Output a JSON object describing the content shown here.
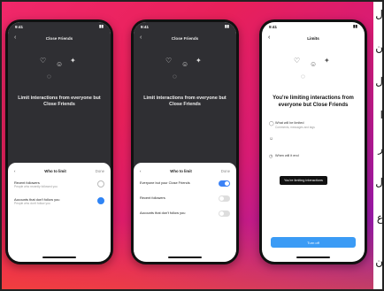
{
  "phone1": {
    "time": "9:41",
    "nav_title": "Close Friends",
    "headline": "Limit interactions from everyone but Close Friends",
    "sub": "",
    "sheet_title": "Who to limit",
    "sheet_action": "Done",
    "options": [
      {
        "label": "Recent followers",
        "detail": "People who recently followed you",
        "selected": false
      },
      {
        "label": "Accounts that don't follow you",
        "detail": "People who don't follow you",
        "selected": true
      }
    ]
  },
  "phone2": {
    "time": "9:41",
    "nav_title": "Close Friends",
    "headline": "Limit interactions from everyone but Close Friends",
    "sheet_title": "Who to limit",
    "sheet_action": "Done",
    "toggles": [
      {
        "label": "Everyone but your Close Friends",
        "detail": "",
        "on": true
      },
      {
        "label": "Recent followers",
        "detail": "",
        "on": false
      },
      {
        "label": "Accounts that don't follow you",
        "detail": "",
        "on": false
      }
    ]
  },
  "phone3": {
    "time": "9:41",
    "nav_title": "Limits",
    "headline": "You're limiting interactions from everyone but Close Friends",
    "items": [
      {
        "icon": "comment-icon",
        "label": "What will be limited",
        "detail": "Comments, messages and tags"
      },
      {
        "icon": "person-icon",
        "label": "",
        "detail": ""
      },
      {
        "icon": "clock-icon",
        "label": "When will it end",
        "detail": ""
      }
    ],
    "tooltip": "You're limiting interactions",
    "cta": "Turn off"
  },
  "side_glyphs": [
    "ل",
    "ن",
    "ل",
    "ا",
    "ر",
    "ل",
    "ع",
    "ن"
  ],
  "colors": {
    "accent": "#3b82f6",
    "bg_start": "#f0286a",
    "bg_end": "#7b1fb8"
  }
}
